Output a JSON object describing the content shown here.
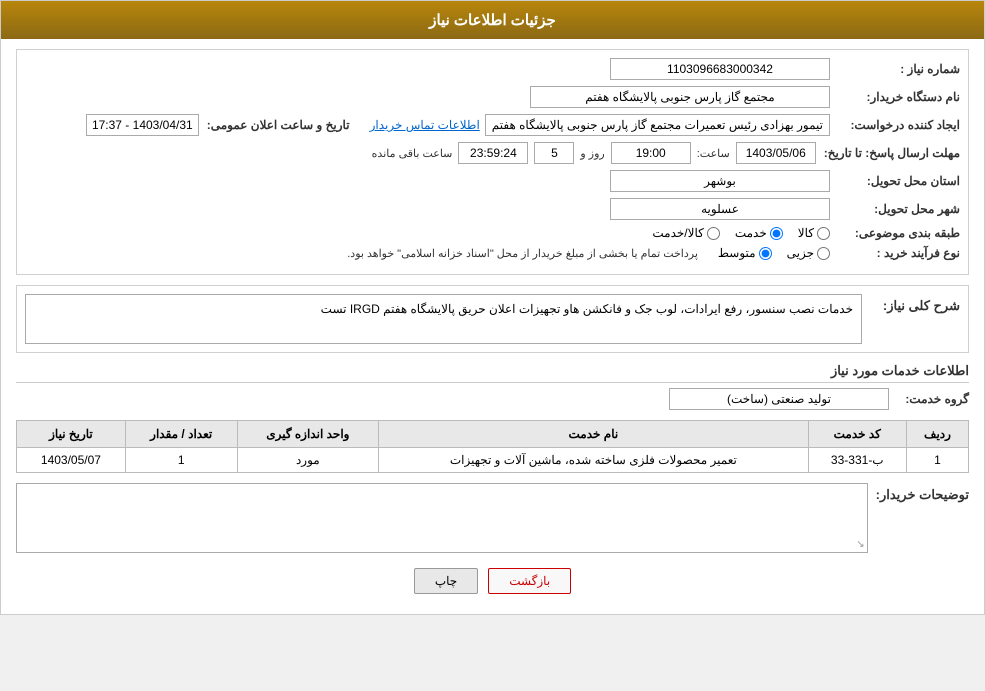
{
  "header": {
    "title": "جزئیات اطلاعات نیاز"
  },
  "fields": {
    "need_number_label": "شماره نیاز :",
    "need_number_value": "1103096683000342",
    "buyer_org_label": "نام دستگاه خریدار:",
    "buyer_org_value": "مجتمع گاز پارس جنوبی  پالایشگاه هفتم",
    "creator_label": "ایجاد کننده درخواست:",
    "creator_value": "تیمور بهزادی رئیس تعمیرات مجتمع گاز پارس جنوبی  پالایشگاه هفتم",
    "contact_link": "اطلاعات تماس خریدار",
    "announce_label": "تاریخ و ساعت اعلان عمومی:",
    "announce_value": "1403/04/31 - 17:37",
    "deadline_label": "مهلت ارسال پاسخ: تا تاریخ:",
    "deadline_date": "1403/05/06",
    "deadline_time_label": "ساعت:",
    "deadline_time": "19:00",
    "deadline_day_label": "روز و",
    "deadline_days": "5",
    "deadline_countdown_label": "ساعت باقی مانده",
    "deadline_countdown": "23:59:24",
    "province_label": "استان محل تحویل:",
    "province_value": "بوشهر",
    "city_label": "شهر محل تحویل:",
    "city_value": "عسلویه",
    "category_label": "طبقه بندی موضوعی:",
    "category_options": [
      "کالا",
      "خدمت",
      "کالا/خدمت"
    ],
    "category_selected": "خدمت",
    "process_label": "نوع فرآیند خرید :",
    "process_options": [
      "جزیی",
      "متوسط"
    ],
    "process_selected": "متوسط",
    "process_note": "پرداخت تمام یا بخشی از مبلغ خریدار از محل \"اسناد خزانه اسلامی\" خواهد بود.",
    "need_summary_label": "شرح کلی نیاز:",
    "need_summary_text": "خدمات نصب سنسور، رفع ایرادات، لوب جک و فانکشن\nهاو تجهیزات اعلان حریق پالایشگاه هفتم IRGD تست",
    "service_info_title": "اطلاعات خدمات مورد نیاز",
    "service_group_label": "گروه خدمت:",
    "service_group_value": "تولید صنعتی (ساخت)",
    "table_headers": {
      "row_num": "ردیف",
      "service_code": "کد خدمت",
      "service_name": "نام خدمت",
      "unit": "واحد اندازه گیری",
      "quantity": "تعداد / مقدار",
      "date": "تاریخ نیاز"
    },
    "table_rows": [
      {
        "row_num": "1",
        "service_code": "ب-331-33",
        "service_name": "تعمیر محصولات فلزی ساخته شده، ماشین آلات و تجهیزات",
        "unit": "مورد",
        "quantity": "1",
        "date": "1403/05/07"
      }
    ],
    "buyer_notes_label": "توضیحات خریدار:"
  },
  "buttons": {
    "print": "چاپ",
    "back": "بازگشت"
  },
  "colors": {
    "header_bg": "#8b6914",
    "accent": "#b8860b"
  }
}
